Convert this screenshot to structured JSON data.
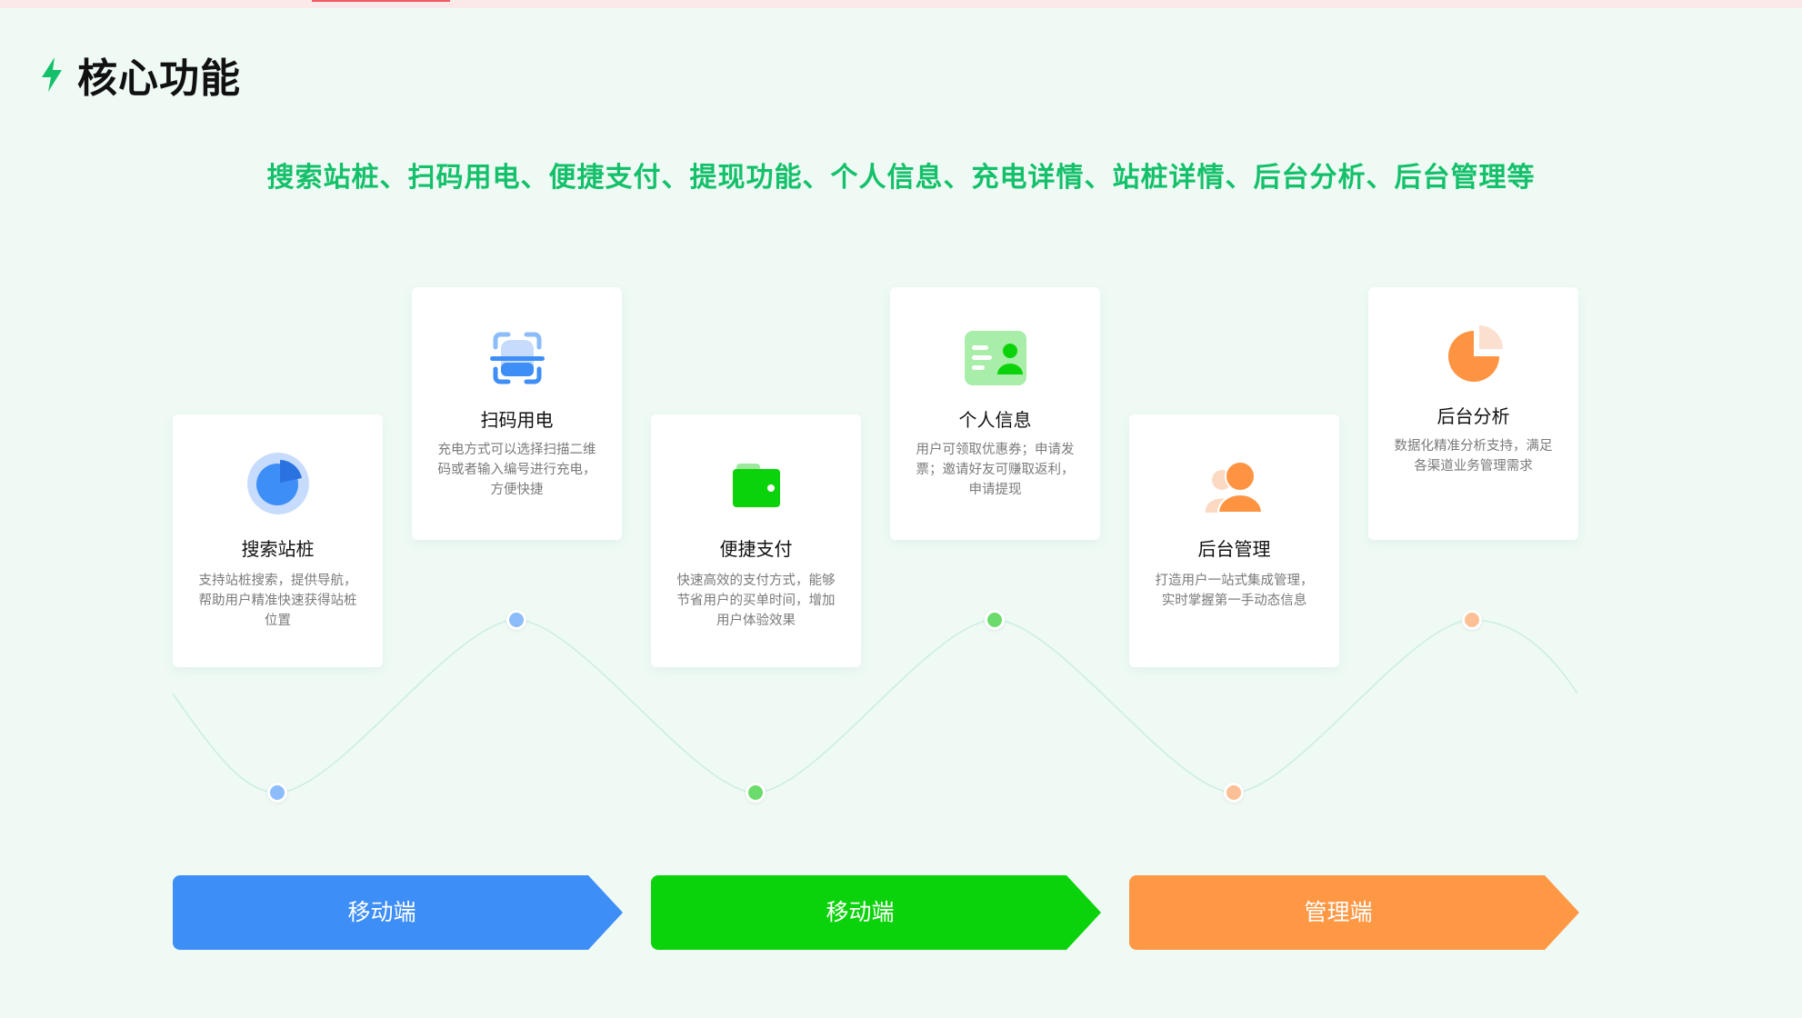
{
  "header": {
    "title": "核心功能",
    "subtitle": "搜索站桩、扫码用电、便捷支付、提现功能、个人信息、充电详情、站桩详情、后台分析、后台管理等"
  },
  "cards": [
    {
      "title": "搜索站桩",
      "desc": "支持站桩搜索，提供导航，帮助用户精准快速获得站桩位置",
      "icon": "pie-target-icon",
      "color": "#3e8ef7"
    },
    {
      "title": "扫码用电",
      "desc": "充电方式可以选择扫描二维码或者输入编号进行充电，方便快捷",
      "icon": "scan-icon",
      "color": "#3e8ef7"
    },
    {
      "title": "便捷支付",
      "desc": "快速高效的支付方式，能够节省用户的买单时间，增加用户体验效果",
      "icon": "wallet-icon",
      "color": "#0fd40f"
    },
    {
      "title": "个人信息",
      "desc": "用户可领取优惠券；申请发票；邀请好友可赚取返利，申请提现",
      "icon": "id-card-icon",
      "color": "#0fd40f"
    },
    {
      "title": "后台管理",
      "desc": "打造用户一站式集成管理，实时掌握第一手动态信息",
      "icon": "user-icon",
      "color": "#fe9441"
    },
    {
      "title": "后台分析",
      "desc": "数据化精准分析支持，满足各渠道业务管理需求",
      "icon": "pie-chart-icon",
      "color": "#fe9441"
    }
  ],
  "bars": [
    {
      "label": "移动端",
      "color": "#3e8ef7"
    },
    {
      "label": "移动端",
      "color": "#0bd30b"
    },
    {
      "label": "管理端",
      "color": "#fe9845"
    }
  ],
  "colors": {
    "background": "#effaf5",
    "accent_green": "#14c06a",
    "dot_blue": "#8cbcfa",
    "dot_green": "#6bdc6b",
    "dot_orange": "#fdbf95",
    "wave_line": "#cdeee0"
  }
}
